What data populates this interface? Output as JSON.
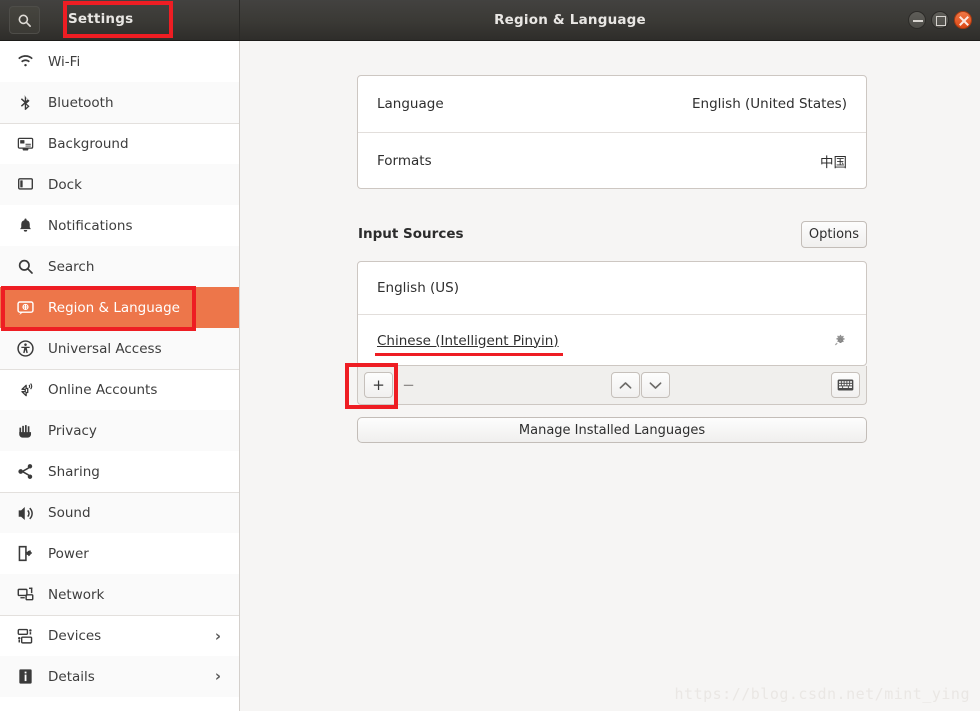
{
  "titlebar": {
    "search_icon": "search-icon",
    "app_name": "Settings",
    "window_title": "Region & Language",
    "minimize_label": "Minimize",
    "maximize_label": "Maximize",
    "close_label": "Close"
  },
  "sidebar": {
    "items": [
      {
        "label": "Wi-Fi",
        "icon": "wifi-icon",
        "selected": false,
        "chevron": "",
        "separator_above": false
      },
      {
        "label": "Bluetooth",
        "icon": "bluetooth-icon",
        "selected": false,
        "chevron": "",
        "separator_above": false
      },
      {
        "label": "Background",
        "icon": "background-icon",
        "selected": false,
        "chevron": "",
        "separator_above": true
      },
      {
        "label": "Dock",
        "icon": "dock-icon",
        "selected": false,
        "chevron": "",
        "separator_above": false
      },
      {
        "label": "Notifications",
        "icon": "bell-icon",
        "selected": false,
        "chevron": "",
        "separator_above": false
      },
      {
        "label": "Search",
        "icon": "search-icon",
        "selected": false,
        "chevron": "",
        "separator_above": false
      },
      {
        "label": "Region & Language",
        "icon": "region-language-icon",
        "selected": true,
        "chevron": "",
        "separator_above": false
      },
      {
        "label": "Universal Access",
        "icon": "accessibility-icon",
        "selected": false,
        "chevron": "",
        "separator_above": false
      },
      {
        "label": "Online Accounts",
        "icon": "online-accounts-icon",
        "selected": false,
        "chevron": "",
        "separator_above": true
      },
      {
        "label": "Privacy",
        "icon": "privacy-hand-icon",
        "selected": false,
        "chevron": "",
        "separator_above": false
      },
      {
        "label": "Sharing",
        "icon": "share-icon",
        "selected": false,
        "chevron": "",
        "separator_above": false
      },
      {
        "label": "Sound",
        "icon": "speaker-icon",
        "selected": false,
        "chevron": "",
        "separator_above": true
      },
      {
        "label": "Power",
        "icon": "power-icon",
        "selected": false,
        "chevron": "",
        "separator_above": false
      },
      {
        "label": "Network",
        "icon": "network-icon",
        "selected": false,
        "chevron": "",
        "separator_above": false
      },
      {
        "label": "Devices",
        "icon": "devices-icon",
        "selected": false,
        "chevron": "›",
        "separator_above": true
      },
      {
        "label": "Details",
        "icon": "details-info-icon",
        "selected": false,
        "chevron": "›",
        "separator_above": false
      }
    ]
  },
  "main": {
    "language_card": {
      "rows": [
        {
          "key": "Language",
          "value": "English (United States)"
        },
        {
          "key": "Formats",
          "value": "中国"
        }
      ]
    },
    "input_sources": {
      "section_title": "Input Sources",
      "options_button": "Options",
      "sources": [
        {
          "name": "English (US)",
          "underlined": false,
          "has_gear": false
        },
        {
          "name": "Chinese (Intelligent Pinyin)",
          "underlined": true,
          "has_gear": true
        }
      ],
      "toolbar": {
        "add_label": "+",
        "remove_label": "−",
        "move_up_icon": "chevron-up-icon",
        "move_down_icon": "chevron-down-icon",
        "keyboard_icon": "keyboard-icon"
      }
    },
    "manage_button": "Manage Installed Languages"
  },
  "annotations": {
    "highlight_color": "#ee1d23",
    "boxes": [
      {
        "target": "Settings"
      },
      {
        "target": "Region & Language"
      },
      {
        "target": "+"
      }
    ],
    "underline_target": "Chinese (Intelligent Pinyin)"
  },
  "watermark": "https://blog.csdn.net/mint_ying",
  "colors": {
    "accent_orange": "#ed764a",
    "close_button": "#dd4814",
    "titlebar": "#3a3935",
    "content_bg": "#f6f5f4"
  }
}
